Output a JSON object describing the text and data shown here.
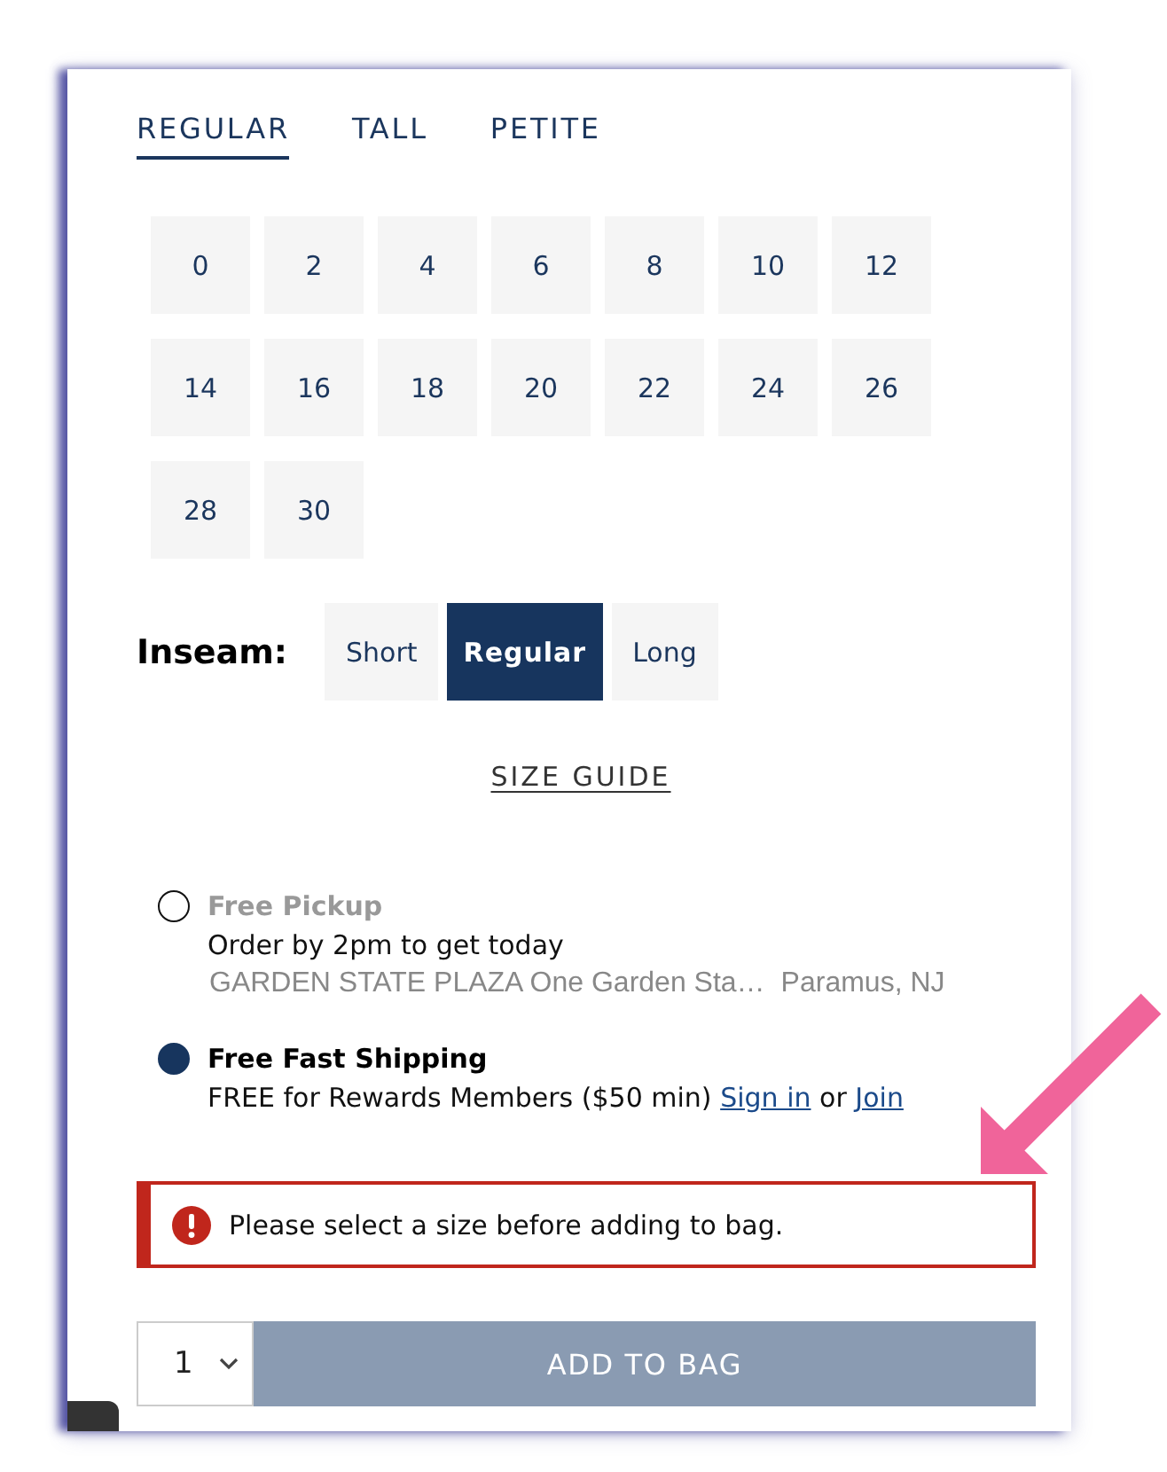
{
  "size_tabs": [
    {
      "label": "REGULAR",
      "selected": true
    },
    {
      "label": "TALL",
      "selected": false
    },
    {
      "label": "PETITE",
      "selected": false
    }
  ],
  "sizes": [
    {
      "label": "0",
      "selected": false
    },
    {
      "label": "2",
      "selected": false
    },
    {
      "label": "4",
      "selected": false
    },
    {
      "label": "6",
      "selected": false
    },
    {
      "label": "8",
      "selected": false
    },
    {
      "label": "10",
      "selected": false
    },
    {
      "label": "12",
      "selected": false
    },
    {
      "label": "14",
      "selected": false
    },
    {
      "label": "16",
      "selected": false
    },
    {
      "label": "18",
      "selected": false
    },
    {
      "label": "20",
      "selected": false
    },
    {
      "label": "22",
      "selected": false
    },
    {
      "label": "24",
      "selected": false
    },
    {
      "label": "26",
      "selected": false
    },
    {
      "label": "28",
      "selected": false
    },
    {
      "label": "30",
      "selected": false
    }
  ],
  "inseam": {
    "label": "Inseam:",
    "options": [
      {
        "label": "Short",
        "selected": false
      },
      {
        "label": "Regular",
        "selected": true
      },
      {
        "label": "Long",
        "selected": false
      }
    ]
  },
  "size_guide": "SIZE GUIDE",
  "delivery_options": [
    {
      "title": "Free Pickup",
      "selected": false,
      "lines": [
        {
          "kind": "note",
          "parts": [
            {
              "kind": "text",
              "text": "Order by 2pm to get today"
            }
          ]
        },
        {
          "kind": "store",
          "texts": [
            "GARDEN STATE PLAZA One Garden Sta…",
            "Paramus, NJ"
          ]
        }
      ]
    },
    {
      "title": "Free Fast Shipping",
      "selected": true,
      "lines": [
        {
          "kind": "note",
          "parts": [
            {
              "kind": "text",
              "text": "FREE for Rewards Members ($50 min)"
            },
            {
              "kind": "link",
              "text": "Sign in"
            },
            {
              "kind": "text",
              "text": "or"
            },
            {
              "kind": "link",
              "text": "Join"
            }
          ]
        }
      ]
    }
  ],
  "error": {
    "message": "Please select a size before adding to bag."
  },
  "quantity": {
    "value": "1"
  },
  "add_to_bag": {
    "label": "ADD TO BAG",
    "disabled": true
  }
}
